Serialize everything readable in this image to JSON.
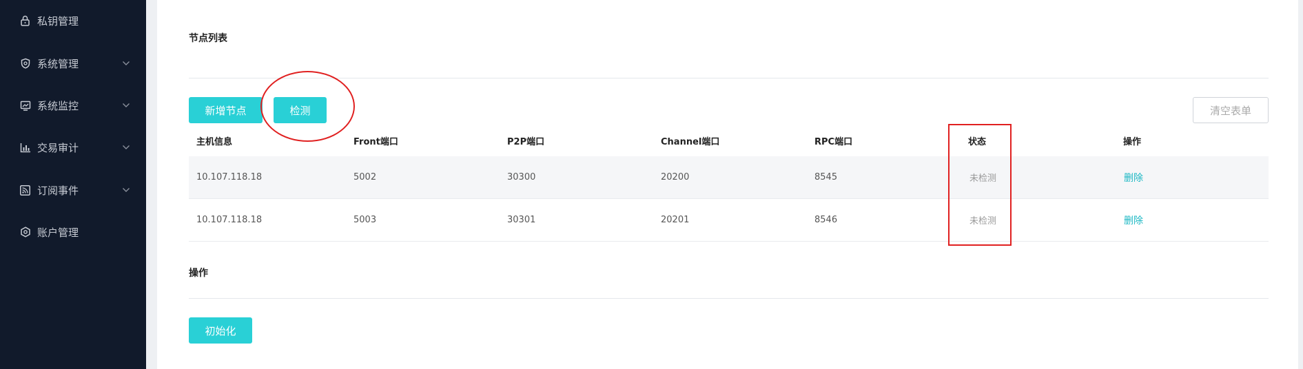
{
  "sidebar": {
    "items": [
      {
        "label": "私钥管理",
        "icon": "lock-icon",
        "has_chevron": false
      },
      {
        "label": "系统管理",
        "icon": "shield-icon",
        "has_chevron": true
      },
      {
        "label": "系统监控",
        "icon": "monitor-chart-icon",
        "has_chevron": true
      },
      {
        "label": "交易审计",
        "icon": "bar-chart-icon",
        "has_chevron": true
      },
      {
        "label": "订阅事件",
        "icon": "rss-icon",
        "has_chevron": true
      },
      {
        "label": "账户管理",
        "icon": "hexagon-gear-icon",
        "has_chevron": false
      }
    ]
  },
  "node_section": {
    "title": "节点列表",
    "add_button": "新增节点",
    "check_button": "检测",
    "clear_button": "清空表单"
  },
  "table": {
    "headers": [
      "主机信息",
      "Front端口",
      "P2P端口",
      "Channel端口",
      "RPC端口",
      "状态",
      "操作"
    ],
    "rows": [
      {
        "host": "10.107.118.18",
        "front": "5002",
        "p2p": "30300",
        "channel": "20200",
        "rpc": "8545",
        "status": "未检测",
        "action": "删除"
      },
      {
        "host": "10.107.118.18",
        "front": "5003",
        "p2p": "30301",
        "channel": "20201",
        "rpc": "8546",
        "status": "未检测",
        "action": "删除"
      }
    ]
  },
  "operation_section": {
    "title": "操作",
    "init_button": "初始化"
  },
  "colors": {
    "sidebar_bg": "#111a2b",
    "accent": "#29d0d6",
    "link": "#1db8c4",
    "annotation": "#e02020"
  }
}
